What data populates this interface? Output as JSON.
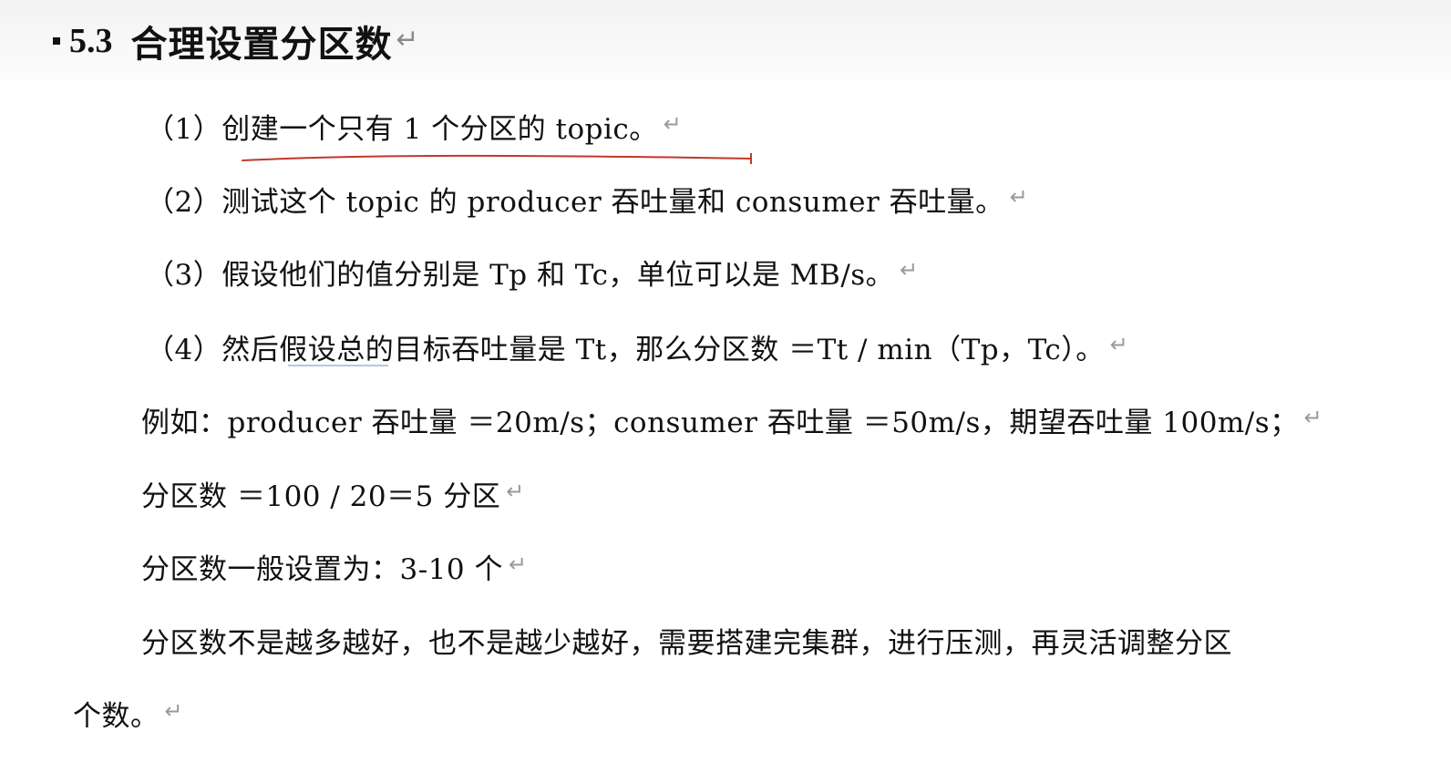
{
  "heading": {
    "number": "5.3",
    "title": "合理设置分区数"
  },
  "paragraph_mark": "↵",
  "lines": [
    "（1）创建一个只有 1 个分区的 topic。",
    "（2）测试这个 topic 的 producer 吞吐量和 consumer 吞吐量。",
    "（3）假设他们的值分别是 Tp 和 Tc，单位可以是 MB/s。",
    "（4）然后假设总的目标吞吐量是 Tt，那么分区数 ＝Tt / min（Tp，Tc）。",
    "例如：producer 吞吐量 ＝20m/s；consumer 吞吐量 ＝50m/s，期望吞吐量 100m/s；",
    "分区数 ＝100 / 20＝5 分区",
    "分区数一般设置为：3-10 个",
    "分区数不是越多越好，也不是越少越好，需要搭建完集群，进行压测，再灵活调整分区",
    "个数。"
  ],
  "colors": {
    "text": "#111111",
    "paragraph_mark": "#9a9a9a",
    "annotation_red": "#c0392b",
    "header_band": "#f3f3f3"
  }
}
